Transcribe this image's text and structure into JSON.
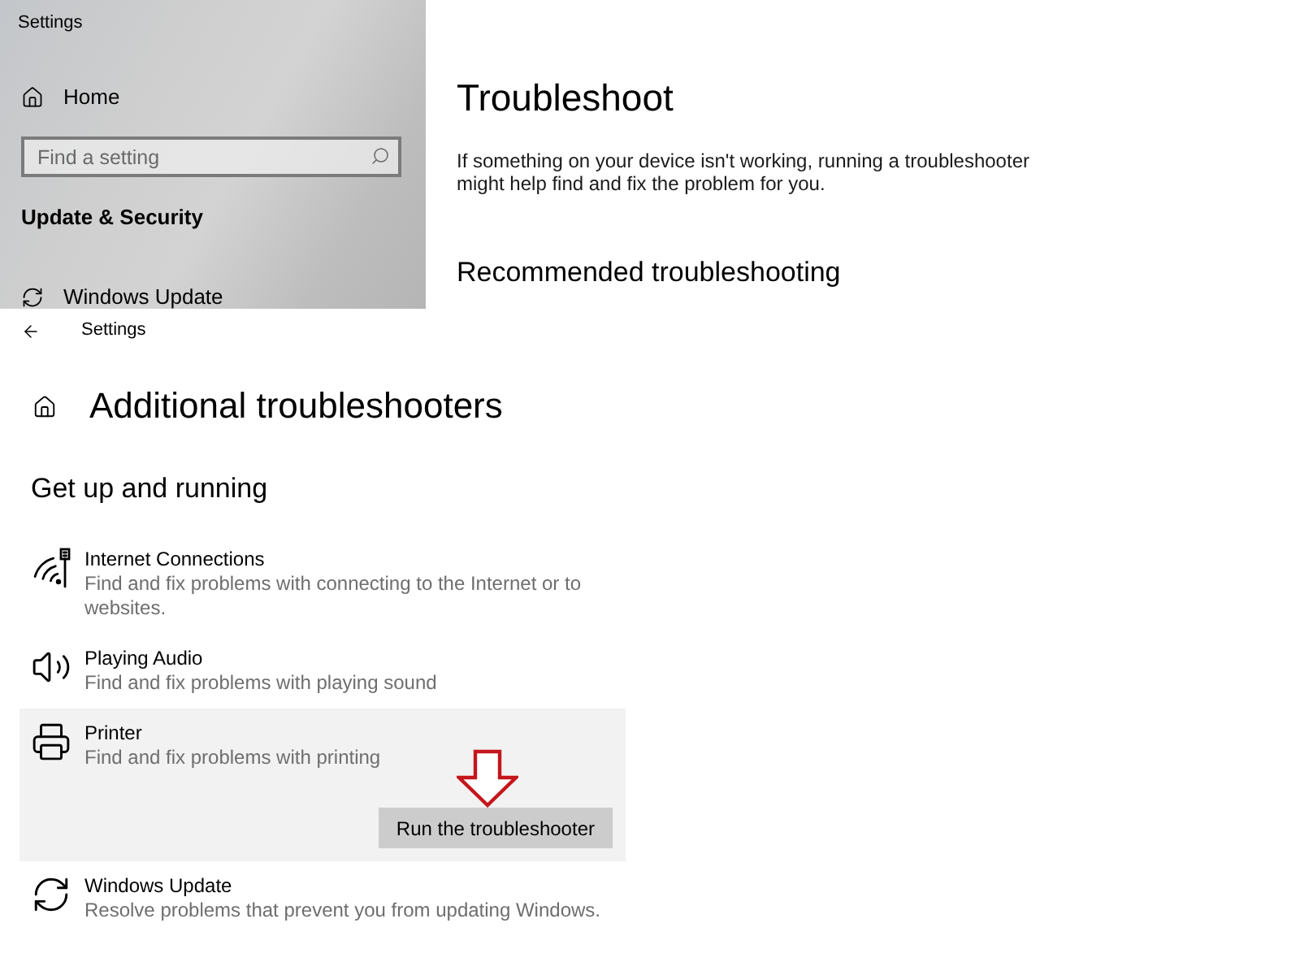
{
  "back_window": {
    "title": "Settings",
    "sidebar": {
      "home": "Home",
      "search": {
        "placeholder": "Find a setting"
      },
      "section": "Update & Security",
      "items": [
        {
          "label": "Windows Update"
        }
      ]
    },
    "page": {
      "title": "Troubleshoot",
      "description": "If something on your device isn't working, running a troubleshooter might help find and fix the problem for you.",
      "subheading": "Recommended troubleshooting"
    }
  },
  "front_window": {
    "title": "Settings",
    "heading": "Additional troubleshooters",
    "section": "Get up and running",
    "troubleshooters": [
      {
        "name": "Internet Connections",
        "description": "Find and fix problems with connecting to the Internet or to websites.",
        "selected": false
      },
      {
        "name": "Playing Audio",
        "description": "Find and fix problems with playing sound",
        "selected": false
      },
      {
        "name": "Printer",
        "description": "Find and fix problems with printing",
        "selected": true,
        "button": "Run the troubleshooter"
      },
      {
        "name": "Windows Update",
        "description": "Resolve problems that prevent you from updating Windows.",
        "selected": false
      }
    ]
  }
}
